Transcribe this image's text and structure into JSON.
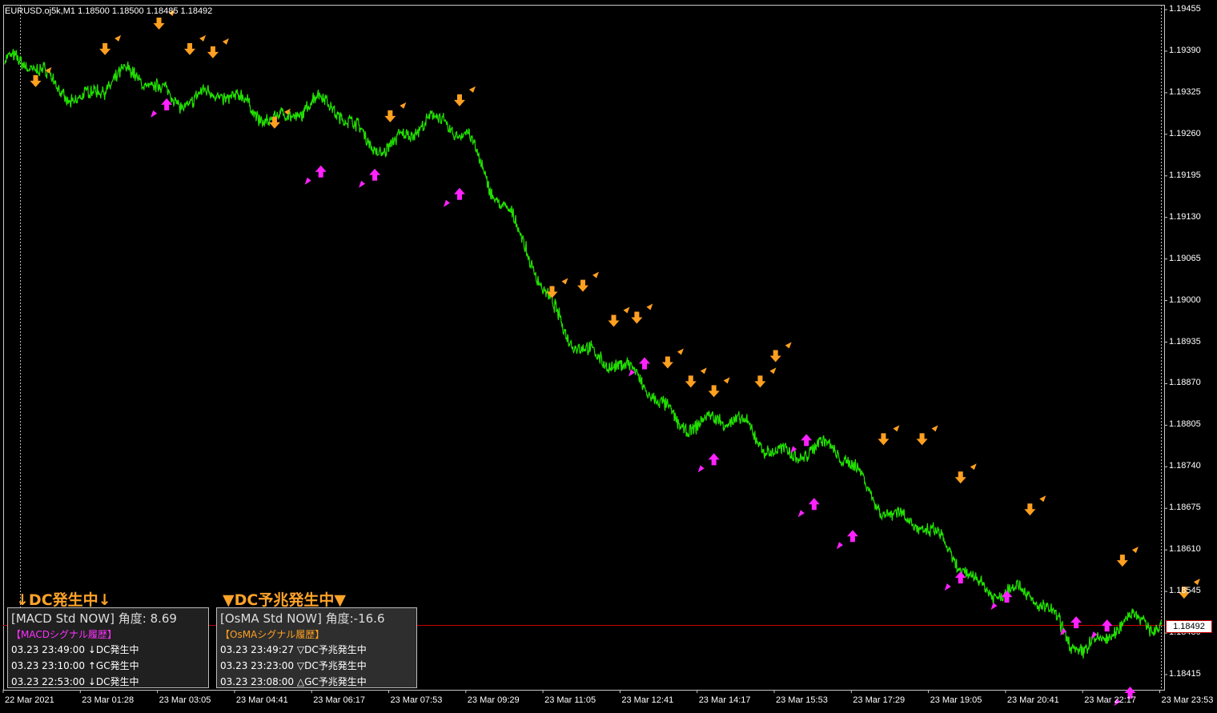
{
  "header": {
    "text": "EURUSD.oj5k,M1  1.18500 1.18500 1.18485 1.18492"
  },
  "current_price": "1.18492",
  "price_axis": [
    "1.19455",
    "1.19390",
    "1.19325",
    "1.19260",
    "1.19195",
    "1.19130",
    "1.19065",
    "1.19000",
    "1.18935",
    "1.18870",
    "1.18805",
    "1.18740",
    "1.18675",
    "1.18610",
    "1.18545",
    "1.18480",
    "1.18415"
  ],
  "time_axis": [
    "22 Mar 2021",
    "23 Mar 01:28",
    "23 Mar 03:05",
    "23 Mar 04:41",
    "23 Mar 06:17",
    "23 Mar 07:53",
    "23 Mar 09:29",
    "23 Mar 11:05",
    "23 Mar 12:41",
    "23 Mar 14:17",
    "23 Mar 15:53",
    "23 Mar 17:29",
    "23 Mar 19:05",
    "23 Mar 20:41",
    "23 Mar 22:17",
    "23 Mar 23:53"
  ],
  "colors": {
    "price_line": "#22e000",
    "down_arrow": "#ffa020",
    "up_arrow": "#ff22ff",
    "current_line": "#c80000",
    "banner": "#ffa32a",
    "osma_history_title": "#ffa020",
    "macd_history_title": "#ff30ff"
  },
  "banners": {
    "macd": "↓DC発生中↓",
    "osma": "▼DC予兆発生中▼"
  },
  "macd_panel": {
    "title": "[MACD Std NOW] 角度: 8.69",
    "history_title": "【MACDシグナル履歴】",
    "rows": [
      "03.23 23:49:00 ↓DC発生中",
      "03.23 23:10:00 ↑GC発生中",
      "03.23 22:53:00 ↓DC発生中"
    ]
  },
  "osma_panel": {
    "title": "[OsMA Std NOW] 角度:-16.6",
    "history_title": "【OsMAシグナル履歴】",
    "rows": [
      "03.23 23:49:27 ▽DC予兆発生中",
      "03.23 23:23:00 ▽DC予兆発生中",
      "03.23 23:08:00 △GC予兆発生中"
    ]
  },
  "chart_data": {
    "type": "line",
    "title": "EURUSD.oj5k,M1",
    "x": [
      "22 Mar 2021",
      "23 Mar 01:28",
      "23 Mar 03:05",
      "23 Mar 04:41",
      "23 Mar 06:17",
      "23 Mar 07:53",
      "23 Mar 09:29",
      "23 Mar 11:05",
      "23 Mar 12:41",
      "23 Mar 14:17",
      "23 Mar 15:53",
      "23 Mar 17:29",
      "23 Mar 19:05",
      "23 Mar 20:41",
      "23 Mar 22:17",
      "23 Mar 23:53"
    ],
    "series": [
      {
        "values": [
          1.19365,
          1.1933,
          1.1934,
          1.193,
          1.193,
          1.1925,
          1.19275,
          1.19,
          1.1888,
          1.1881,
          1.1878,
          1.1874,
          1.1862,
          1.18545,
          1.1847,
          1.18492
        ]
      }
    ],
    "ylim": [
      1.184,
      1.1947
    ],
    "down_signals": [
      [
        0.4,
        1.1932
      ],
      [
        1.3,
        1.1937
      ],
      [
        2.0,
        1.1941
      ],
      [
        2.4,
        1.1937
      ],
      [
        2.7,
        1.19365
      ],
      [
        3.5,
        1.19255
      ],
      [
        5.0,
        1.19265
      ],
      [
        5.9,
        1.1929
      ],
      [
        7.1,
        1.1899
      ],
      [
        7.5,
        1.19
      ],
      [
        7.9,
        1.18945
      ],
      [
        8.2,
        1.1895
      ],
      [
        8.6,
        1.1888
      ],
      [
        8.9,
        1.1885
      ],
      [
        9.2,
        1.18835
      ],
      [
        9.8,
        1.1885
      ],
      [
        10.0,
        1.1889
      ],
      [
        11.4,
        1.1876
      ],
      [
        11.9,
        1.1876
      ],
      [
        12.4,
        1.187
      ],
      [
        13.3,
        1.1865
      ],
      [
        14.5,
        1.1857
      ],
      [
        15.3,
        1.1852
      ]
    ],
    "up_signals": [
      [
        2.1,
        1.1933
      ],
      [
        4.1,
        1.19225
      ],
      [
        4.8,
        1.1922
      ],
      [
        5.9,
        1.1919
      ],
      [
        8.3,
        1.18925
      ],
      [
        9.2,
        1.18775
      ],
      [
        10.4,
        1.18805
      ],
      [
        10.5,
        1.18705
      ],
      [
        11.0,
        1.18655
      ],
      [
        12.4,
        1.1859
      ],
      [
        13.0,
        1.1856
      ],
      [
        13.9,
        1.1852
      ],
      [
        14.3,
        1.18515
      ],
      [
        14.6,
        1.1841
      ]
    ]
  }
}
